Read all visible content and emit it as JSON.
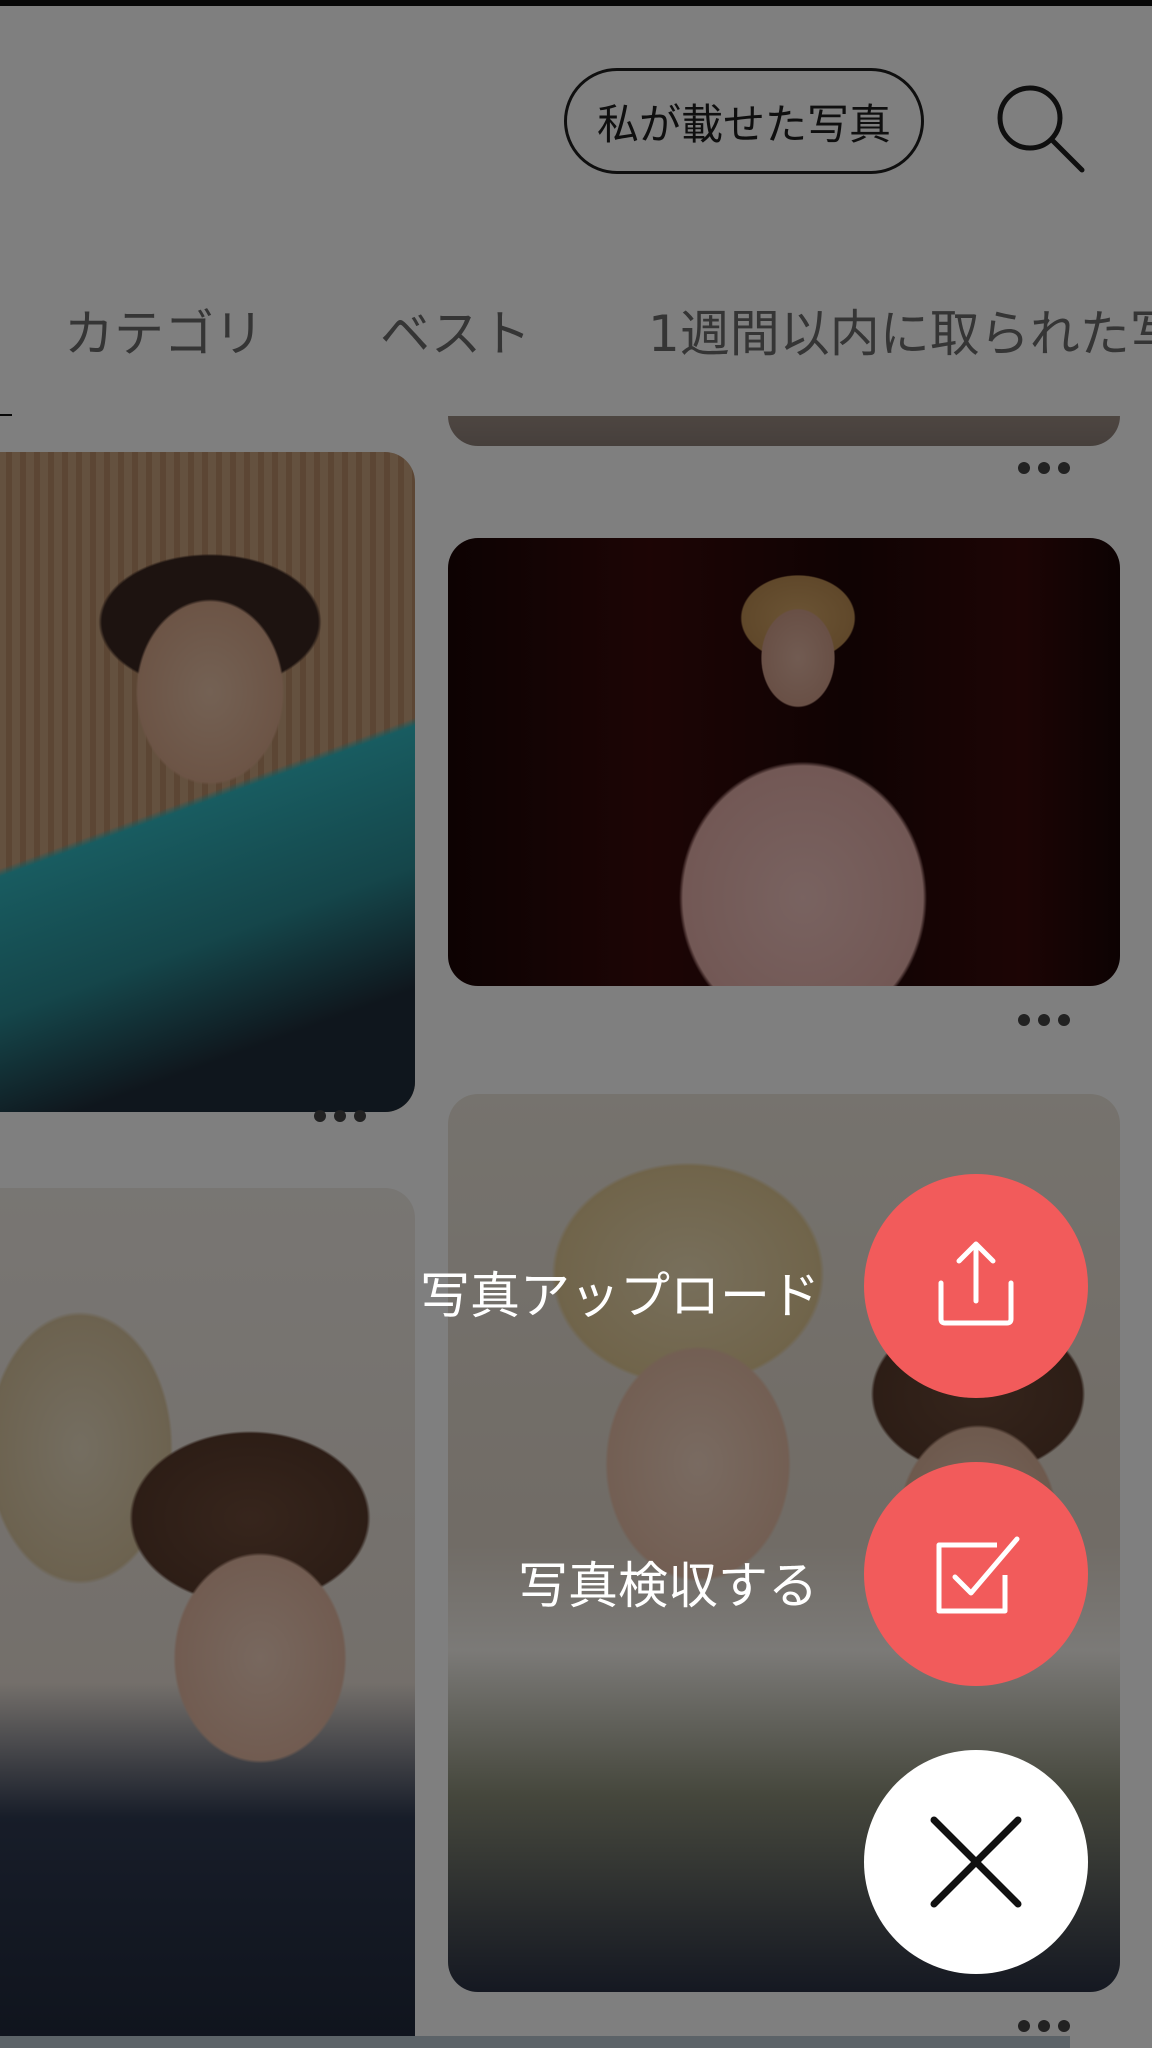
{
  "header": {
    "my_photos_label": "私が載せた写真",
    "search_icon": "search-icon"
  },
  "tabs": [
    {
      "label": "カテゴリ"
    },
    {
      "label": "ベスト"
    },
    {
      "label": "1週間以内に取られた写"
    }
  ],
  "fab_menu": {
    "upload_label": "写真アップロード",
    "upload_icon": "upload-icon",
    "inspect_label": "写真検収する",
    "inspect_icon": "checkbox-icon",
    "close_icon": "close-icon",
    "accent_color": "#f25b5b"
  },
  "feed": {
    "more_icon": "more-dots-icon"
  }
}
